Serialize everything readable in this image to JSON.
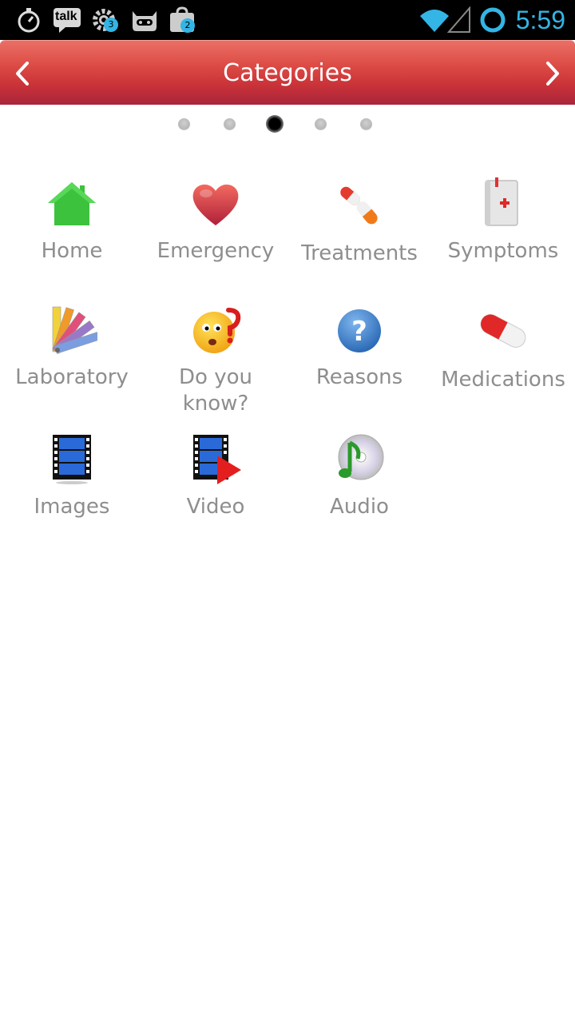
{
  "status_bar": {
    "time": "5:59",
    "talk_label": "talk",
    "settings_badge": "3",
    "store_badge": "2",
    "icons": [
      "stopwatch-icon",
      "talk-icon",
      "settings-icon",
      "cyanogen-icon",
      "play-store-icon",
      "wifi-icon",
      "signal-icon",
      "ring-icon"
    ]
  },
  "header": {
    "title": "Categories",
    "prev_icon": "chevron-left-icon",
    "next_icon": "chevron-right-icon"
  },
  "pager": {
    "count": 5,
    "active_index": 2
  },
  "categories": [
    {
      "label": "Home",
      "icon": "house-icon"
    },
    {
      "label": "Emergency",
      "icon": "heart-icon"
    },
    {
      "label": "Treatments",
      "icon": "capsules-icon"
    },
    {
      "label": "Symptoms",
      "icon": "first-aid-book-icon"
    },
    {
      "label": "Laboratory",
      "icon": "color-swatch-icon"
    },
    {
      "label": "Do you know?",
      "icon": "thinking-face-icon"
    },
    {
      "label": "Reasons",
      "icon": "question-icon"
    },
    {
      "label": "Medications",
      "icon": "pill-icon"
    },
    {
      "label": "Images",
      "icon": "film-strip-icon"
    },
    {
      "label": "Video",
      "icon": "video-play-icon"
    },
    {
      "label": "Audio",
      "icon": "music-cd-icon"
    }
  ],
  "colors": {
    "header_red": "#dc4a44",
    "status_blue": "#33b5e5",
    "label_gray": "#8e8e8e"
  }
}
